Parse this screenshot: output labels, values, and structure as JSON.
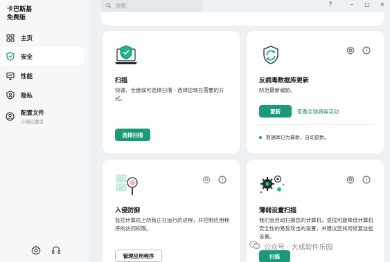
{
  "brand": {
    "line1": "卡巴斯基",
    "line2": "免费版"
  },
  "sidebar": {
    "items": [
      {
        "label": "主页",
        "icon": "grid-icon"
      },
      {
        "label": "安全",
        "icon": "shield-check-icon"
      },
      {
        "label": "性能",
        "icon": "monitor-icon"
      },
      {
        "label": "隐私",
        "icon": "privacy-shield-icon"
      },
      {
        "label": "配置文件",
        "sub": "订阅已激活",
        "icon": "user-profile-icon"
      }
    ],
    "active_index": 1
  },
  "search": {
    "placeholder": "搜索"
  },
  "window_controls": {
    "help": "?",
    "minimize": "–",
    "maximize": "□",
    "close": "✕"
  },
  "cards": {
    "scan": {
      "title": "扫描",
      "desc": "快速、全盘或可选择扫描 - 选择您现在需要的方式。",
      "button": "选择扫描"
    },
    "db_update": {
      "title": "反病毒数据库更新",
      "desc": "防范最新威胁。",
      "button": "更新",
      "link": "查看全球病毒活动",
      "status": "数据库已为最新，自动更新。"
    },
    "intrusion": {
      "title": "入侵防御",
      "desc": "监控计算机上所有正在运行的进程，并控制应用程序的访问权限。",
      "button": "管理应用程序"
    },
    "vuln_scan": {
      "title": "薄弱设置扫描",
      "desc": "我们会自动扫描您的计算机，查找可能降低计算机安全性的易受攻击的设置，并建议您如何修复这些设置。",
      "button": "扫描"
    }
  },
  "watermark": "公众号 · 大成软件乐园",
  "colors": {
    "accent": "#1a9a78",
    "background": "#eef1f4",
    "sidebar": "#f6f7f9"
  }
}
